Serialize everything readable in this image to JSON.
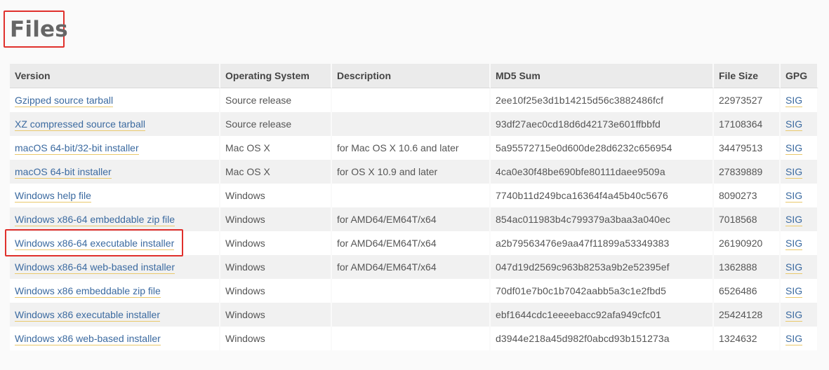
{
  "section": {
    "title": "Files"
  },
  "table": {
    "headers": {
      "version": "Version",
      "os": "Operating System",
      "description": "Description",
      "md5": "MD5 Sum",
      "size": "File Size",
      "gpg": "GPG"
    },
    "rows": [
      {
        "version": "Gzipped source tarball",
        "os": "Source release",
        "description": "",
        "md5": "2ee10f25e3d1b14215d56c3882486fcf",
        "size": "22973527",
        "gpg": "SIG"
      },
      {
        "version": "XZ compressed source tarball",
        "os": "Source release",
        "description": "",
        "md5": "93df27aec0cd18d6d42173e601ffbbfd",
        "size": "17108364",
        "gpg": "SIG"
      },
      {
        "version": "macOS 64-bit/32-bit installer",
        "os": "Mac OS X",
        "description": "for Mac OS X 10.6 and later",
        "md5": "5a95572715e0d600de28d6232c656954",
        "size": "34479513",
        "gpg": "SIG"
      },
      {
        "version": "macOS 64-bit installer",
        "os": "Mac OS X",
        "description": "for OS X 10.9 and later",
        "md5": "4ca0e30f48be690bfe80111daee9509a",
        "size": "27839889",
        "gpg": "SIG"
      },
      {
        "version": "Windows help file",
        "os": "Windows",
        "description": "",
        "md5": "7740b11d249bca16364f4a45b40c5676",
        "size": "8090273",
        "gpg": "SIG"
      },
      {
        "version": "Windows x86-64 embeddable zip file",
        "os": "Windows",
        "description": "for AMD64/EM64T/x64",
        "md5": "854ac011983b4c799379a3baa3a040ec",
        "size": "7018568",
        "gpg": "SIG"
      },
      {
        "version": "Windows x86-64 executable installer",
        "os": "Windows",
        "description": "for AMD64/EM64T/x64",
        "md5": "a2b79563476e9aa47f11899a53349383",
        "size": "26190920",
        "gpg": "SIG"
      },
      {
        "version": "Windows x86-64 web-based installer",
        "os": "Windows",
        "description": "for AMD64/EM64T/x64",
        "md5": "047d19d2569c963b8253a9b2e52395ef",
        "size": "1362888",
        "gpg": "SIG"
      },
      {
        "version": "Windows x86 embeddable zip file",
        "os": "Windows",
        "description": "",
        "md5": "70df01e7b0c1b7042aabb5a3c1e2fbd5",
        "size": "6526486",
        "gpg": "SIG"
      },
      {
        "version": "Windows x86 executable installer",
        "os": "Windows",
        "description": "",
        "md5": "ebf1644cdc1eeeebacc92afa949cfc01",
        "size": "25424128",
        "gpg": "SIG"
      },
      {
        "version": "Windows x86 web-based installer",
        "os": "Windows",
        "description": "",
        "md5": "d3944e218a45d982f0abcd93b151273a",
        "size": "1324632",
        "gpg": "SIG"
      }
    ]
  },
  "colors": {
    "link": "#3b6aa0",
    "link_underline": "#e9c86b",
    "annotation_box": "#e0302c",
    "header_bg": "#ebebeb",
    "row_alt_bg": "#f1f1f1"
  }
}
